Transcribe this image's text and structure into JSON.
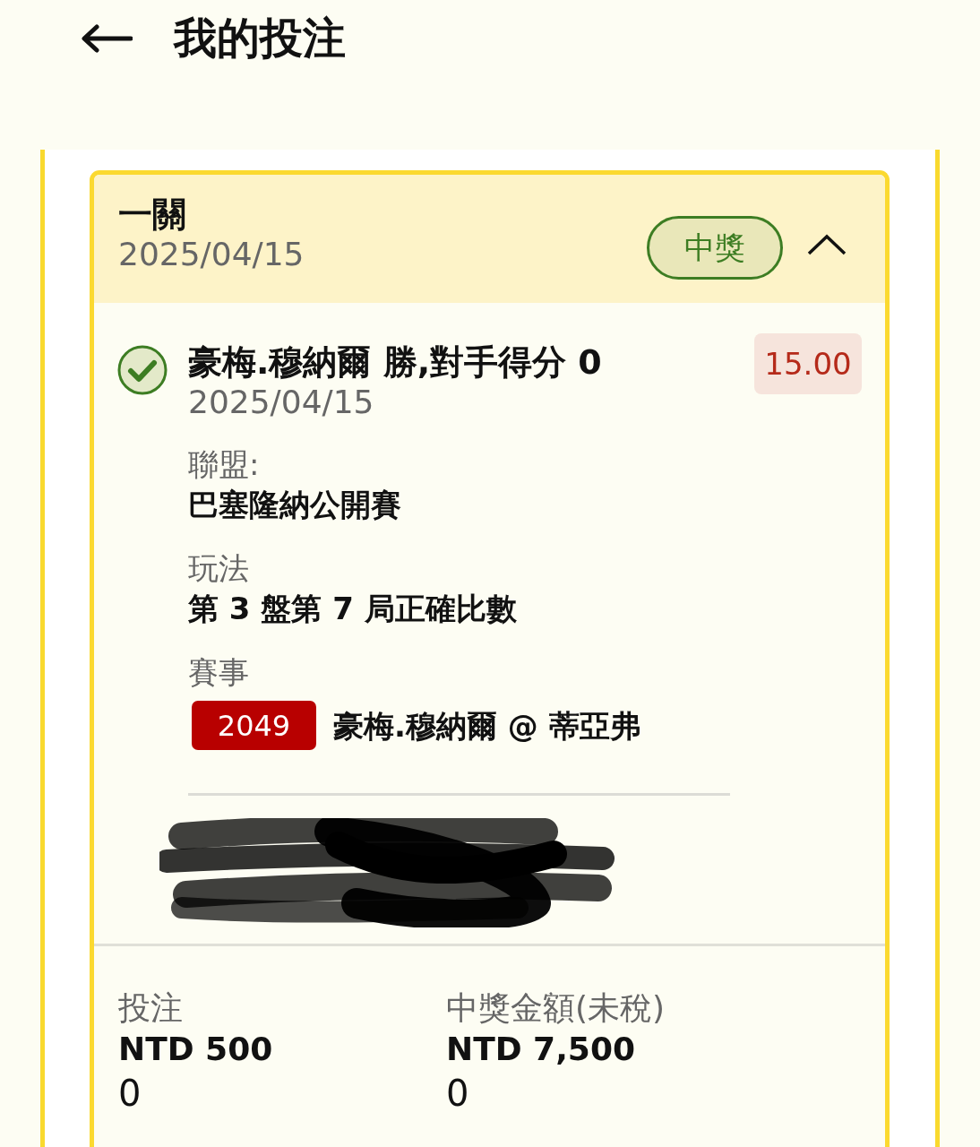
{
  "header": {
    "title": "我的投注"
  },
  "bet": {
    "type": "一關",
    "date": "2025/04/15",
    "status": "中獎",
    "expanded": true,
    "selection": {
      "title": "豪梅.穆納爾 勝,對手得分 0",
      "date": "2025/04/15",
      "won": true,
      "odds": "15.00",
      "fields": [
        {
          "label": "聯盟:",
          "value": "巴塞隆納公開賽"
        },
        {
          "label": "玩法",
          "value": "第 3 盤第 7 局正確比數"
        }
      ],
      "event": {
        "label": "賽事",
        "code": "2049",
        "name": "豪梅.穆納爾 @ 蒂亞弗"
      }
    },
    "summary": [
      {
        "label": "投注",
        "amount": "NTD 500",
        "note": "0"
      },
      {
        "label": "中獎金額(未稅)",
        "amount": "NTD 7,500",
        "note": "0"
      }
    ]
  }
}
